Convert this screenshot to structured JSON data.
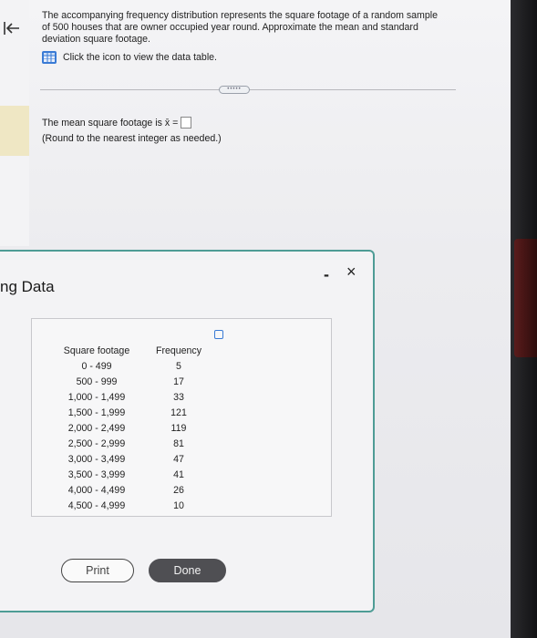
{
  "question": {
    "text": "The accompanying frequency distribution represents the square footage of a random sample of 500 houses that are owner occupied year round. Approximate the mean and standard deviation square footage.",
    "data_link_label": "Click the icon to view the data table."
  },
  "answer": {
    "mean_prompt": "The mean square footage is x̄ =",
    "round_note": "(Round to the nearest integer as needed.)",
    "value": ""
  },
  "more_pill": "•••••",
  "modal": {
    "title": "ng Data",
    "minimize_label": "-",
    "close_label": "×",
    "print_label": "Print",
    "done_label": "Done",
    "table": {
      "headers": [
        "Square footage",
        "Frequency"
      ],
      "rows": [
        [
          "0 - 499",
          "5"
        ],
        [
          "500 - 999",
          "17"
        ],
        [
          "1,000 - 1,499",
          "33"
        ],
        [
          "1,500 - 1,999",
          "121"
        ],
        [
          "2,000 - 2,499",
          "119"
        ],
        [
          "2,500 - 2,999",
          "81"
        ],
        [
          "3,000 - 3,499",
          "47"
        ],
        [
          "3,500 - 3,999",
          "41"
        ],
        [
          "4,000 - 4,499",
          "26"
        ],
        [
          "4,500 - 4,999",
          "10"
        ]
      ]
    }
  },
  "colors": {
    "modal_border": "#4e9c95",
    "done_button": "#4f4f53",
    "icon_blue": "#3a7bd5"
  }
}
